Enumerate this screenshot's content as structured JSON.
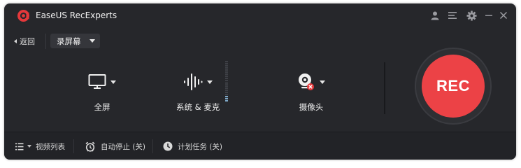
{
  "app": {
    "title": "EaseUS RecExperts",
    "brand_color": "#e5383b"
  },
  "window_controls": {
    "account_icon": "user-icon",
    "menu_icon": "hamburger-menu-icon",
    "settings_icon": "gear-icon",
    "minimize_icon": "minimize-icon",
    "close_icon": "close-icon"
  },
  "toolbar": {
    "back_label": "返回",
    "mode_selected": "录屏幕"
  },
  "sources": {
    "screen": {
      "label": "全屏",
      "icon": "monitor-icon"
    },
    "audio": {
      "label": "系统 & 麦克",
      "icon": "audio-waveform-icon",
      "level": 0.15
    },
    "camera": {
      "label": "摄像头",
      "icon": "webcam-off-icon"
    }
  },
  "rec_button": {
    "label": "REC",
    "color": "#ec4246"
  },
  "bottom": {
    "video_list": "视频列表",
    "auto_stop": "自动停止 (关)",
    "schedule": "计划任务 (关)"
  }
}
